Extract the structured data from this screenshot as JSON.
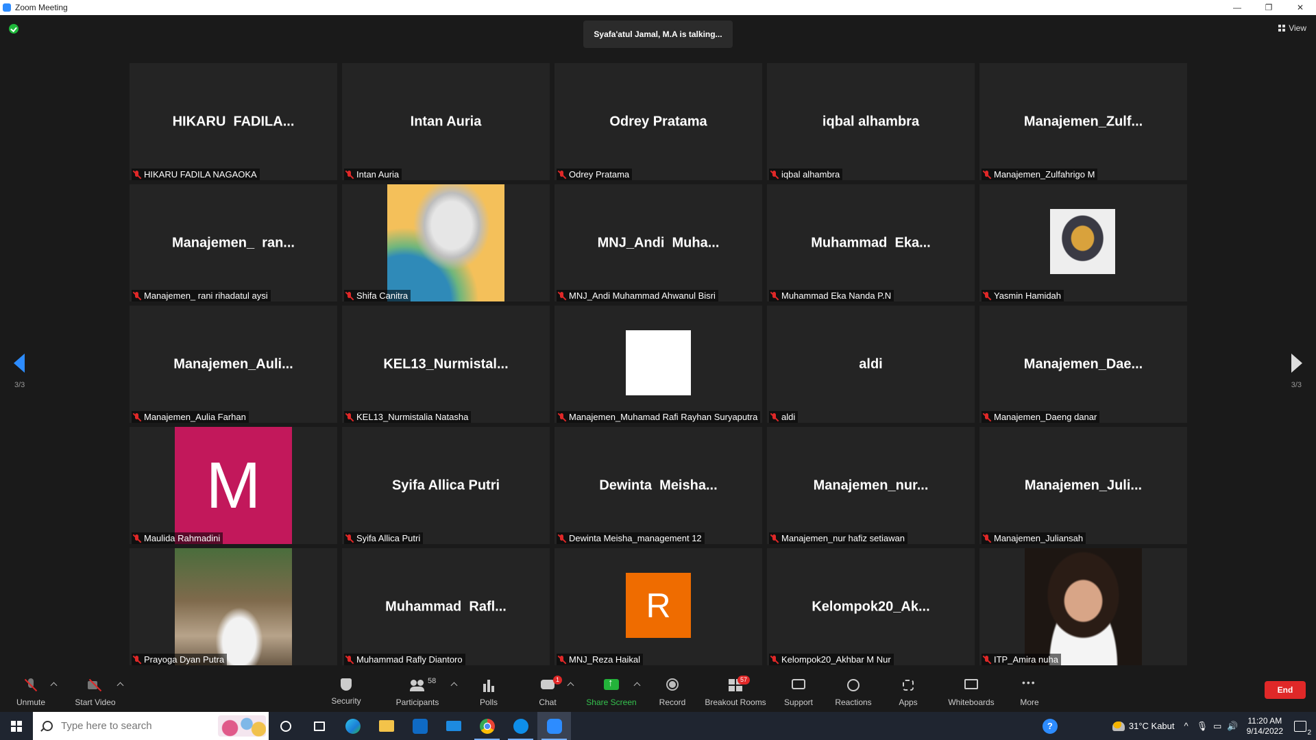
{
  "window": {
    "title": "Zoom Meeting",
    "controls": [
      "—",
      "❐",
      "✕"
    ]
  },
  "meeting": {
    "talking": "Syafa'atul Jamal, M.A is talking...",
    "view_label": "View",
    "page_left": "3/3",
    "page_right": "3/3"
  },
  "tiles": [
    {
      "big": "HIKARU  FADILA...",
      "label": "HIKARU FADILA NAGAOKA"
    },
    {
      "big": "Intan Auria",
      "label": "Intan Auria"
    },
    {
      "big": "Odrey Pratama",
      "label": "Odrey Pratama"
    },
    {
      "big": "iqbal alhambra",
      "label": "iqbal alhambra"
    },
    {
      "big": "Manajemen_Zulf...",
      "label": "Manajemen_Zulfahrigo M"
    },
    {
      "big": "Manajemen_  ran...",
      "label": "Manajemen_ rani rihadatul aysi"
    },
    {
      "big": "",
      "label": "Shifa Canitra",
      "image": "sky"
    },
    {
      "big": "MNJ_Andi  Muha...",
      "label": "MNJ_Andi Muhammad Ahwanul Bisri"
    },
    {
      "big": "Muhammad  Eka...",
      "label": "Muhammad Eka Nanda P.N"
    },
    {
      "big": "",
      "label": "Yasmin Hamidah",
      "image": "face"
    },
    {
      "big": "Manajemen_Auli...",
      "label": "Manajemen_Aulia Farhan"
    },
    {
      "big": "KEL13_Nurmistal...",
      "label": "KEL13_Nurmistalia Natasha"
    },
    {
      "big": "",
      "label": "Manajemen_Muhamad Rafi Rayhan Suryaputra",
      "image": "white"
    },
    {
      "big": "aldi",
      "label": "aldi"
    },
    {
      "big": "Manajemen_Dae...",
      "label": "Manajemen_Daeng danar"
    },
    {
      "big": "",
      "label": "Maulida Rahmadini",
      "image": "m",
      "letter": "M"
    },
    {
      "big": "Syifa Allica Putri",
      "label": "Syifa Allica Putri"
    },
    {
      "big": "Dewinta  Meisha...",
      "label": "Dewinta Meisha_management 12"
    },
    {
      "big": "Manajemen_nur...",
      "label": "Manajemen_nur hafiz setiawan"
    },
    {
      "big": "Manajemen_Juli...",
      "label": "Manajemen_Juliansah"
    },
    {
      "big": "",
      "label": "Prayoga Dyan Putra",
      "image": "room"
    },
    {
      "big": "Muhammad  Rafl...",
      "label": "Muhammad Rafly Diantoro"
    },
    {
      "big": "",
      "label": "MNJ_Reza Haikal",
      "image": "r",
      "letter": "R"
    },
    {
      "big": "Kelompok20_Ak...",
      "label": "Kelompok20_Akhbar M Nur"
    },
    {
      "big": "",
      "label": "ITP_Amira nuha",
      "image": "girl"
    }
  ],
  "toolbar": {
    "unmute": "Unmute",
    "start_video": "Start Video",
    "security": "Security",
    "participants": "Participants",
    "participants_count": "58",
    "polls": "Polls",
    "chat": "Chat",
    "chat_badge": "1",
    "share_screen": "Share Screen",
    "record": "Record",
    "breakout_rooms": "Breakout Rooms",
    "breakout_badge": "57",
    "support": "Support",
    "reactions": "Reactions",
    "apps": "Apps",
    "whiteboards": "Whiteboards",
    "more": "More",
    "end": "End"
  },
  "taskbar": {
    "search_placeholder": "Type here to search",
    "weather": "31°C  Kabut",
    "time": "11:20 AM",
    "date": "9/14/2022",
    "notifications": "2"
  }
}
